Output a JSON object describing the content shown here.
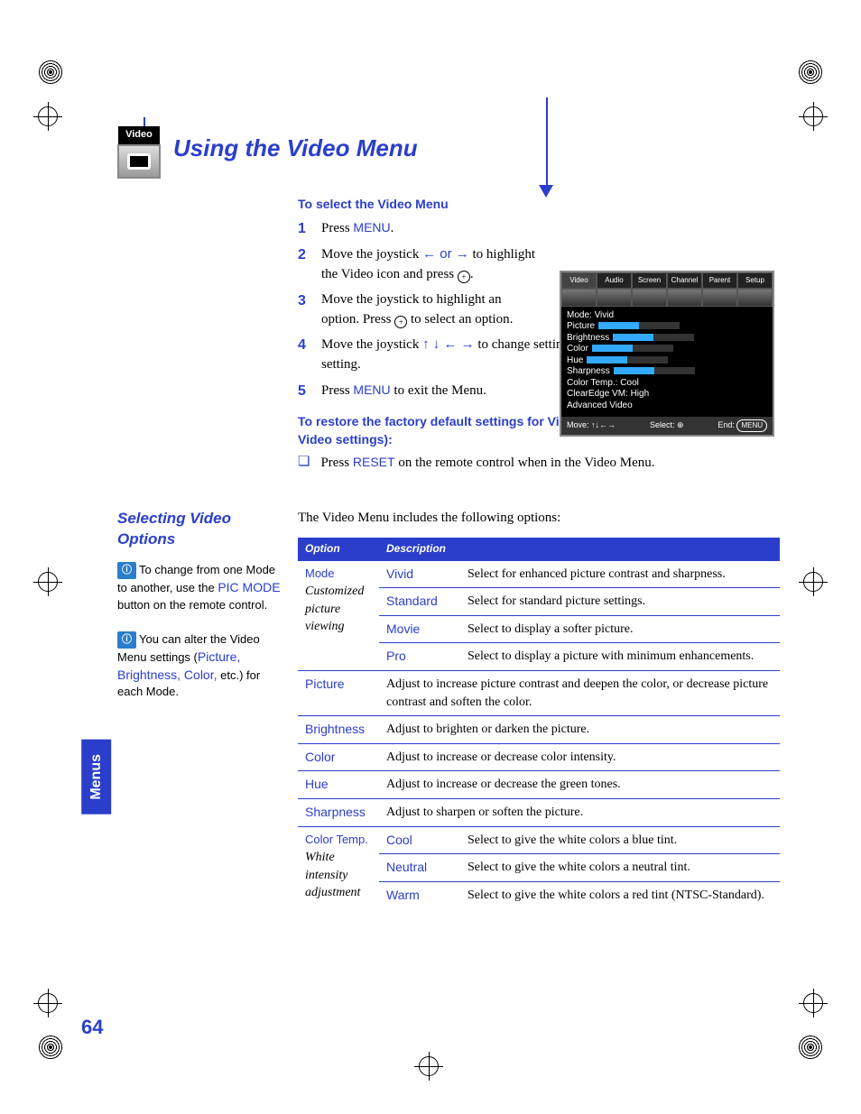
{
  "header": {
    "icon_label": "Video",
    "title": "Using the Video Menu"
  },
  "intro": {
    "heading": "To select the Video Menu",
    "steps": [
      {
        "n": "1",
        "pre": "Press ",
        "accent": "MENU",
        "post": "."
      },
      {
        "n": "2",
        "text": "Move the joystick ",
        "arrows": "← or →",
        "post": " to highlight the Video icon and press ",
        "ring": "⊕",
        "end": "."
      },
      {
        "n": "3",
        "text": "Move the joystick to highlight an option. Press ",
        "ring": "⊕",
        "end": " to select an option."
      },
      {
        "n": "4",
        "text": "Move the joystick ",
        "arrows": "↑ ↓ ← →",
        "post": " to change settings. Press ",
        "ring": "⊕",
        "end": " to select the changed setting."
      },
      {
        "n": "5",
        "pre": "Press ",
        "accent": "MENU",
        "post": " to exit the Menu."
      }
    ],
    "restore_heading": "To restore the factory default settings for Video settings (except for Advanced Video settings):",
    "restore_bullet_pre": "Press ",
    "restore_bullet_accent": "RESET",
    "restore_bullet_post": " on the remote control when in the Video Menu."
  },
  "osd": {
    "tabs": [
      "Video",
      "Audio",
      "Screen",
      "Channel",
      "Parent",
      "Setup"
    ],
    "lines": {
      "mode": "Mode: Vivid",
      "picture": "Picture",
      "brightness": "Brightness",
      "color": "Color",
      "hue": "Hue",
      "sharpness": "Sharpness",
      "colortemp": "Color Temp.: Cool",
      "clearedge": "ClearEdge VM: High",
      "advanced": "Advanced Video"
    },
    "foot": {
      "move": "Move:",
      "select": "Select:",
      "end": "End:",
      "end_btn": "MENU"
    }
  },
  "section2": {
    "heading": "Selecting Video Options",
    "tip1_pre": "To change from one Mode to another, use the ",
    "tip1_accent": "PIC MODE",
    "tip1_post": " button on the remote control.",
    "tip2_pre": "You can alter the Video Menu settings (",
    "tip2_accent": "Picture, Brightness, Color,",
    "tip2_post": " etc.) for each Mode.",
    "intro": "The Video Menu includes the following options:",
    "th_option": "Option",
    "th_desc": "Description",
    "rows": [
      {
        "opt": "Mode",
        "sub": "Customized picture viewing",
        "val": "Vivid",
        "desc": "Select for enhanced picture contrast and sharpness."
      },
      {
        "val": "Standard",
        "desc": "Select for standard picture settings."
      },
      {
        "val": "Movie",
        "desc": "Select to display a softer picture."
      },
      {
        "val": "Pro",
        "desc": "Select to display a picture with minimum enhancements."
      },
      {
        "opt": "Picture",
        "desc": "Adjust to increase picture contrast and deepen the color, or decrease picture contrast and soften the color."
      },
      {
        "opt": "Brightness",
        "desc": "Adjust to brighten or darken the picture."
      },
      {
        "opt": "Color",
        "desc": "Adjust to increase or decrease color intensity."
      },
      {
        "opt": "Hue",
        "desc": "Adjust to increase or decrease the green tones."
      },
      {
        "opt": "Sharpness",
        "desc": "Adjust to sharpen or soften the picture."
      },
      {
        "opt": "Color Temp.",
        "sub": "White intensity adjustment",
        "val": "Cool",
        "desc": "Select to give the white colors a blue tint."
      },
      {
        "val": "Neutral",
        "desc": "Select to give the white colors a neutral tint."
      },
      {
        "val": "Warm",
        "desc": "Select to give the white colors a red tint (NTSC-Standard)."
      }
    ]
  },
  "page": {
    "sidetab": "Menus",
    "number": "64"
  }
}
